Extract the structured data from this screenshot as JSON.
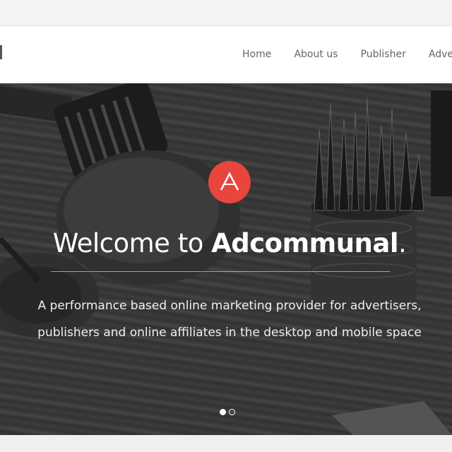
{
  "nav": {
    "items": [
      "Home",
      "About us",
      "Publisher",
      "Advert"
    ]
  },
  "hero": {
    "badge_letter": "A",
    "title_prefix": "Welcome to ",
    "title_brand": "Adcommunal",
    "title_suffix": ".",
    "subtitle_line1": "A performance based online marketing provider for advertisers,",
    "subtitle_line2": "publishers and online affiliates in the desktop and mobile space",
    "slides": 2,
    "active_slide": 1
  },
  "colors": {
    "accent": "#e8453c",
    "nav_text": "#666666",
    "hero_text": "#ffffff"
  },
  "icons": {
    "hero_badge": "a-logo-icon"
  }
}
